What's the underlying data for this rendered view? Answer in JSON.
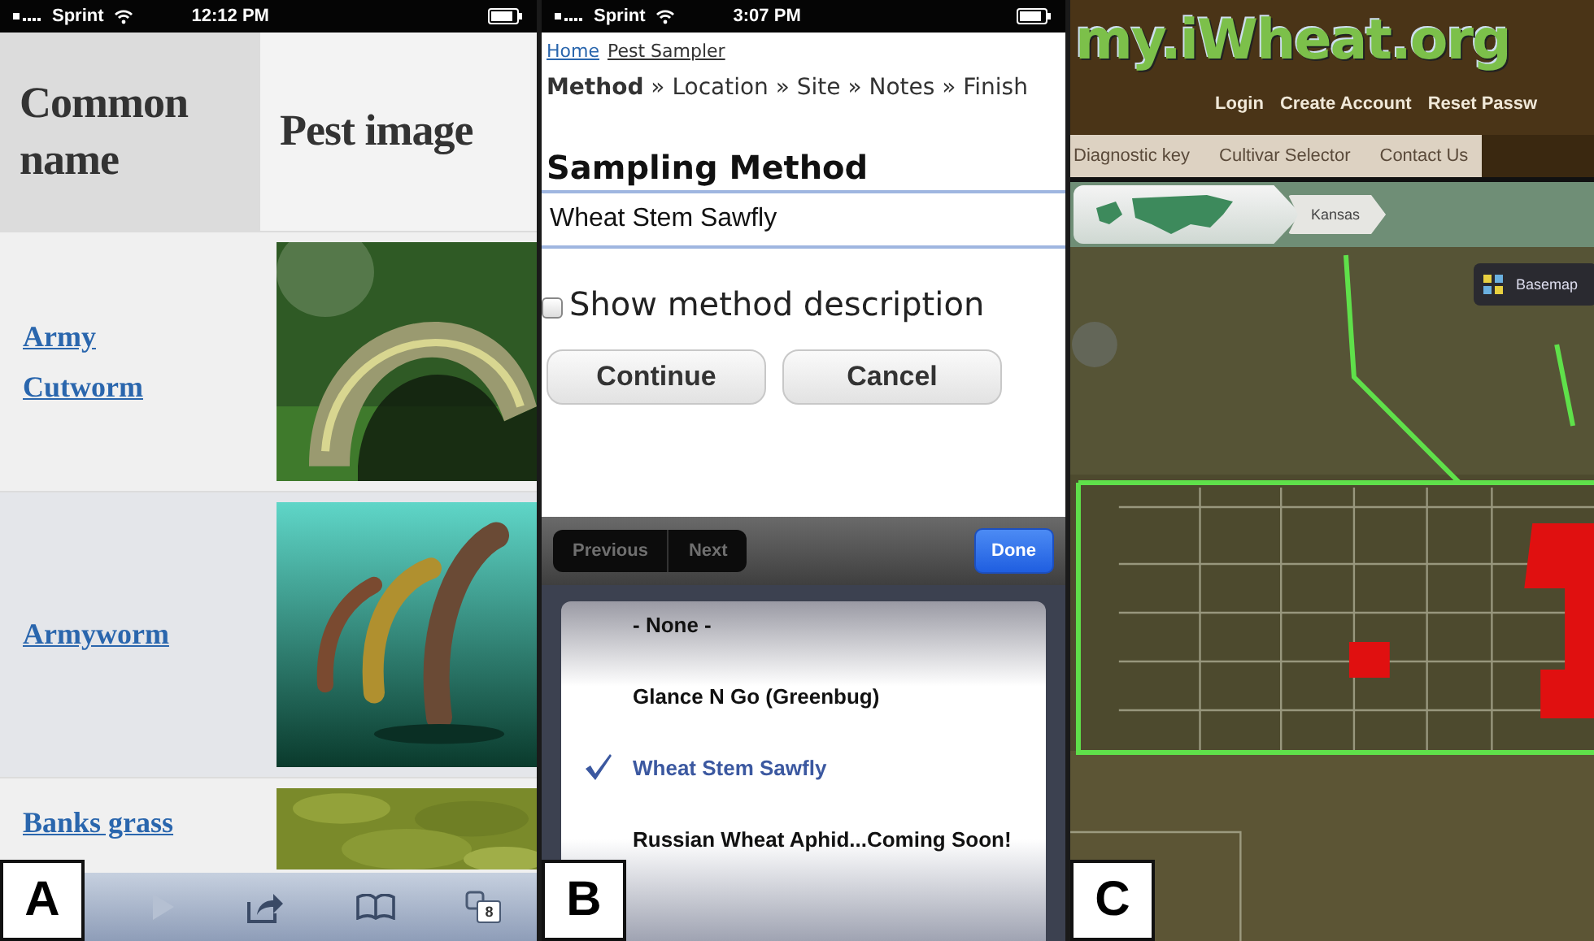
{
  "panel_a": {
    "label": "A",
    "status_bar": {
      "carrier": "Sprint",
      "time": "12:12 PM"
    },
    "table": {
      "columns": [
        "Common name",
        "Pest image"
      ],
      "rows": [
        {
          "common_name": "Army Cutworm"
        },
        {
          "common_name": "Armyworm"
        },
        {
          "common_name": "Banks grass"
        }
      ]
    },
    "toolbar": {
      "forward_enabled": false,
      "tab_count": "8"
    }
  },
  "panel_b": {
    "label": "B",
    "status_bar": {
      "carrier": "Sprint",
      "time": "3:07 PM"
    },
    "breadcrumb": [
      "Home",
      "Pest Sampler"
    ],
    "steps": "**Method** » Location » Site » Notes » Finish",
    "heading": "Sampling Method",
    "select": {
      "value": "Wheat Stem Sawfly"
    },
    "checkbox": {
      "label": "Show method description",
      "checked": false
    },
    "buttons": [
      "Continue",
      "Cancel"
    ],
    "accessory": {
      "previous": "Previous",
      "next": "Next",
      "done": "Done"
    },
    "picker": [
      {
        "label": "- None -",
        "selected": false
      },
      {
        "label": "Glance N Go (Greenbug)",
        "selected": false
      },
      {
        "label": "Wheat Stem Sawfly",
        "selected": true
      },
      {
        "label": "Russian Wheat Aphid...Coming Soon!",
        "selected": false
      }
    ]
  },
  "panel_c": {
    "label": "C",
    "logo": "my.iWheat.org",
    "account_links": [
      "Login",
      "Create Account",
      "Reset Passw"
    ],
    "nav": [
      "Diagnostic key",
      "Cultivar Selector",
      "Contact Us"
    ],
    "map": {
      "kind": "picture",
      "breadcrumb": "Kansas",
      "basemap_button": "Basemap"
    }
  }
}
